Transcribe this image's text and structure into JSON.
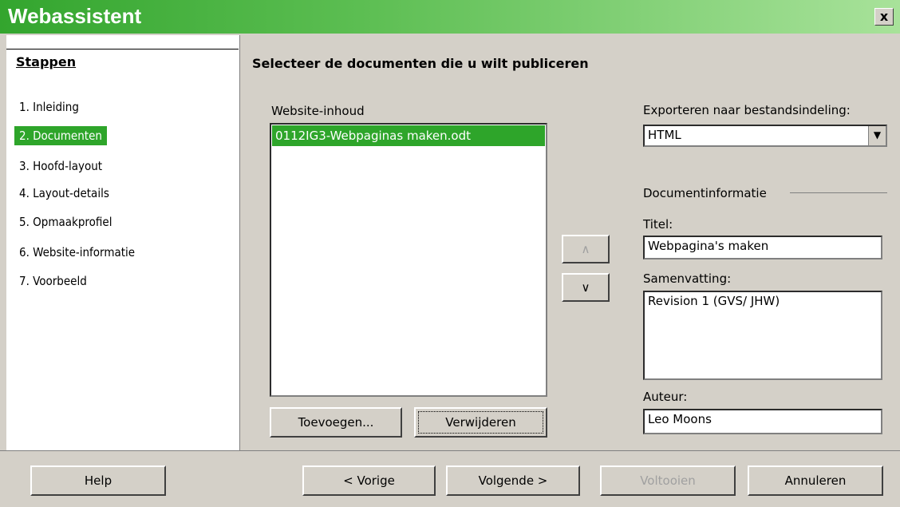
{
  "window": {
    "title": "Webassistent",
    "close_label": "x"
  },
  "sidebar": {
    "heading": "Stappen",
    "steps": [
      {
        "label": "1. Inleiding"
      },
      {
        "label": "2. Documenten"
      },
      {
        "label": "3. Hoofd-layout"
      },
      {
        "label": "4. Layout-details"
      },
      {
        "label": "5. Opmaakprofiel"
      },
      {
        "label": "6. Website-informatie"
      },
      {
        "label": "7. Voorbeeld"
      }
    ],
    "active_step": 1
  },
  "main": {
    "heading": "Selecteer de documenten die u wilt publiceren",
    "content_label": "Website-inhoud",
    "documents": [
      "0112IG3-Webpaginas maken.odt"
    ],
    "add_button": "Toevoegen...",
    "remove_button": "Verwijderen",
    "move_up": "∧",
    "move_down": "∨",
    "export_label": "Exporteren naar bestandsindeling:",
    "export_value": "HTML",
    "docinfo_label": "Documentinformatie",
    "title_label": "Titel:",
    "title_value": "Webpagina's maken",
    "summary_label": "Samenvatting:",
    "summary_value": "Revision 1 (GVS/ JHW)",
    "author_label": "Auteur:",
    "author_value": "Leo Moons"
  },
  "footer": {
    "help": "Help",
    "back": "< Vorige",
    "next": "Volgende >",
    "finish": "Voltooien",
    "cancel": "Annuleren"
  },
  "colors": {
    "accent": "#2ea52a",
    "dialog_bg": "#d4d0c8"
  }
}
